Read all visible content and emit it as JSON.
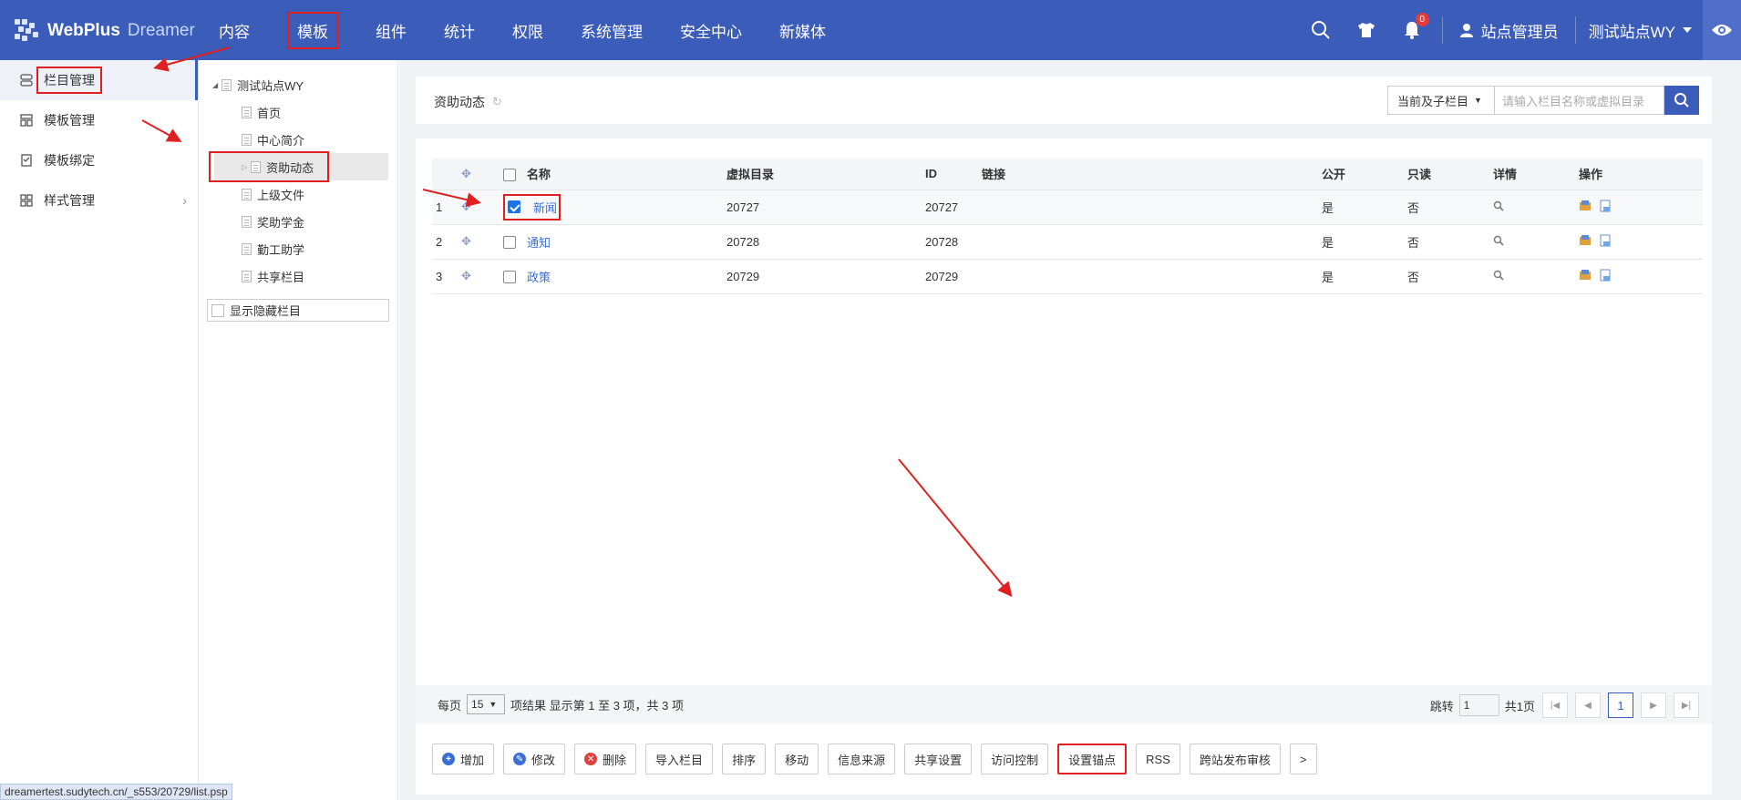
{
  "topbar": {
    "brand": "WebPlus",
    "brand_sub": "Dreamer",
    "nav": [
      "内容",
      "模板",
      "组件",
      "统计",
      "权限",
      "系统管理",
      "安全中心",
      "新媒体"
    ],
    "notification_count": "0",
    "user": "站点管理员",
    "site": "测试站点WY"
  },
  "sidebar": {
    "items": [
      {
        "label": "栏目管理",
        "icon": "column-icon"
      },
      {
        "label": "模板管理",
        "icon": "template-icon"
      },
      {
        "label": "模板绑定",
        "icon": "bind-icon"
      },
      {
        "label": "样式管理",
        "icon": "style-icon"
      }
    ]
  },
  "tree": {
    "root": "测试站点WY",
    "children": [
      "首页",
      "中心简介",
      "资助动态",
      "上级文件",
      "奖助学金",
      "勤工助学",
      "共享栏目"
    ],
    "show_hidden": "显示隐藏栏目"
  },
  "header": {
    "title": "资助动态",
    "scope": "当前及子栏目",
    "search_placeholder": "请输入栏目名称或虚拟目录"
  },
  "table": {
    "columns": [
      "名称",
      "虚拟目录",
      "ID",
      "链接",
      "公开",
      "只读",
      "详情",
      "操作"
    ],
    "rows": [
      {
        "no": "1",
        "name": "新闻",
        "dir": "20727",
        "id": "20727",
        "link": "",
        "public": "是",
        "readonly": "否"
      },
      {
        "no": "2",
        "name": "通知",
        "dir": "20728",
        "id": "20728",
        "link": "",
        "public": "是",
        "readonly": "否"
      },
      {
        "no": "3",
        "name": "政策",
        "dir": "20729",
        "id": "20729",
        "link": "",
        "public": "是",
        "readonly": "否"
      }
    ]
  },
  "pagination": {
    "per_page_label": "每页",
    "per_page": "15",
    "summary": "项结果 显示第 1 至 3 项，共 3 项",
    "jump_label": "跳转",
    "jump_value": "1",
    "total_pages": "共1页",
    "current": "1"
  },
  "actions": [
    "增加",
    "修改",
    "删除",
    "导入栏目",
    "排序",
    "移动",
    "信息来源",
    "共享设置",
    "访问控制",
    "设置锚点",
    "RSS",
    "跨站发布审核",
    ">"
  ],
  "status_url": "dreamertest.sudytech.cn/_s553/20729/list.psp",
  "colors": {
    "primary": "#3b5cb8",
    "annotation": "#e02020"
  }
}
